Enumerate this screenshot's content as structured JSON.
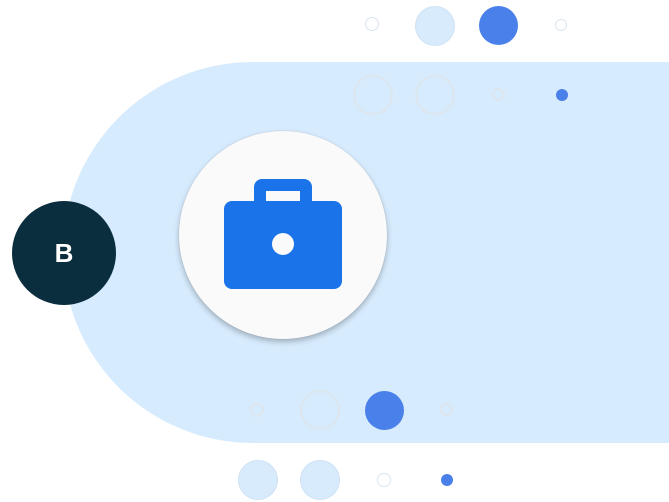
{
  "badge": {
    "letter": "B"
  },
  "icon": {
    "name": "work-briefcase-icon",
    "color": "#1a73e8"
  },
  "colors": {
    "band": "#d6ebfd",
    "badge": "#0b2e3e",
    "accent": "#4a80ea"
  }
}
